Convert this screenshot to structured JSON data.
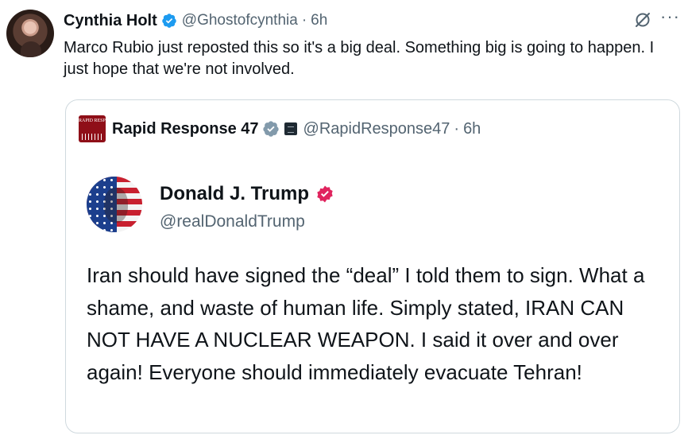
{
  "tweet": {
    "author_name": "Cynthia Holt",
    "author_handle": "@Ghostofcynthia",
    "separator": "·",
    "time": "6h",
    "text": "Marco Rubio just reposted this so it's a big deal. Something big is going to happen. I just hope that we're not involved.",
    "more_label": "···",
    "icons": [
      "verified-badge-icon",
      "grok-icon",
      "more-icon"
    ],
    "accent_color": "#1d9bf0"
  },
  "quote": {
    "author_name": "Rapid Response 47",
    "author_handle": "@RapidResponse47",
    "separator": "·",
    "time": "6h",
    "logo_text": "RAPID RESPONSE",
    "badge_color": "#829aab"
  },
  "truth_post": {
    "author_name": "Donald J. Trump",
    "author_handle": "@realDonaldTrump",
    "badge_color": "#e0245e",
    "text": "Iran should have signed the “deal” I told them to sign. What a shame, and waste of human life. Simply stated, IRAN CAN NOT HAVE A NUCLEAR WEAPON. I said it over and over again! Everyone should immediately evacuate Tehran!"
  }
}
